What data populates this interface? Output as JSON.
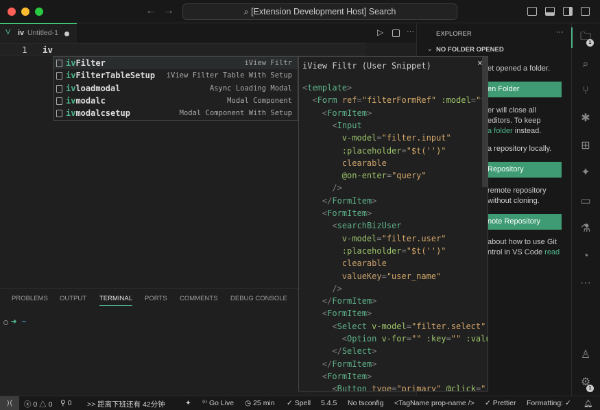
{
  "title": {
    "search": "[Extension Development Host] Search"
  },
  "tab": {
    "name": "iv",
    "file": "Untitled-1"
  },
  "editor": {
    "line_number": "1",
    "text": "iv"
  },
  "suggest": [
    {
      "match": "iv",
      "rest": "Filter",
      "detail": "iView Filtr"
    },
    {
      "match": "iv",
      "rest": "FilterTableSetup",
      "detail": "iView Filter Table With Setup"
    },
    {
      "match": "iv",
      "rest": "loadmodal",
      "detail": "Async Loading Modal"
    },
    {
      "match": "iv",
      "rest": "modalc",
      "detail": "Modal Component"
    },
    {
      "match": "iv",
      "rest": "modalcsetup",
      "detail": "Modal Component With Setup"
    }
  ],
  "detail": {
    "title": "iView Filtr (User Snippet)",
    "close": "×",
    "code": [
      [
        [
          "b",
          "<"
        ],
        [
          "t",
          "template"
        ],
        [
          "b",
          ">"
        ]
      ],
      [
        [
          "p",
          "  "
        ],
        [
          "b",
          "<"
        ],
        [
          "t",
          "Form "
        ],
        [
          "a",
          "ref"
        ],
        [
          "b",
          "="
        ],
        [
          "s",
          "\"filterFormRef\""
        ],
        [
          "p",
          " "
        ],
        [
          "v",
          ":model"
        ],
        [
          "b",
          "="
        ],
        [
          "s",
          "\"f"
        ]
      ],
      [
        [
          "p",
          "    "
        ],
        [
          "b",
          "<"
        ],
        [
          "t",
          "FormItem"
        ],
        [
          "b",
          ">"
        ]
      ],
      [
        [
          "p",
          "      "
        ],
        [
          "b",
          "<"
        ],
        [
          "t",
          "Input"
        ]
      ],
      [
        [
          "p",
          "        "
        ],
        [
          "v",
          "v-model"
        ],
        [
          "b",
          "="
        ],
        [
          "s",
          "\"filter.input\""
        ]
      ],
      [
        [
          "p",
          "        "
        ],
        [
          "v",
          ":placeholder"
        ],
        [
          "b",
          "="
        ],
        [
          "s",
          "\"$t('')\""
        ]
      ],
      [
        [
          "p",
          "        "
        ],
        [
          "a",
          "clearable"
        ]
      ],
      [
        [
          "p",
          "        "
        ],
        [
          "v",
          "@on-enter"
        ],
        [
          "b",
          "="
        ],
        [
          "s",
          "\"query\""
        ]
      ],
      [
        [
          "p",
          "      "
        ],
        [
          "b",
          "/>"
        ]
      ],
      [
        [
          "p",
          "    "
        ],
        [
          "b",
          "</"
        ],
        [
          "t",
          "FormItem"
        ],
        [
          "b",
          ">"
        ]
      ],
      [
        [
          "p",
          "    "
        ],
        [
          "b",
          "<"
        ],
        [
          "t",
          "FormItem"
        ],
        [
          "b",
          ">"
        ]
      ],
      [
        [
          "p",
          "      "
        ],
        [
          "b",
          "<"
        ],
        [
          "t",
          "searchBizUser"
        ]
      ],
      [
        [
          "p",
          "        "
        ],
        [
          "v",
          "v-model"
        ],
        [
          "b",
          "="
        ],
        [
          "s",
          "\"filter.user\""
        ]
      ],
      [
        [
          "p",
          "        "
        ],
        [
          "v",
          ":placeholder"
        ],
        [
          "b",
          "="
        ],
        [
          "s",
          "\"$t('')\""
        ]
      ],
      [
        [
          "p",
          "        "
        ],
        [
          "a",
          "clearable"
        ]
      ],
      [
        [
          "p",
          "        "
        ],
        [
          "a",
          "valueKey"
        ],
        [
          "b",
          "="
        ],
        [
          "s",
          "\"user_name\""
        ]
      ],
      [
        [
          "p",
          "      "
        ],
        [
          "b",
          "/>"
        ]
      ],
      [
        [
          "p",
          "    "
        ],
        [
          "b",
          "</"
        ],
        [
          "t",
          "FormItem"
        ],
        [
          "b",
          ">"
        ]
      ],
      [
        [
          "p",
          "    "
        ],
        [
          "b",
          "<"
        ],
        [
          "t",
          "FormItem"
        ],
        [
          "b",
          ">"
        ]
      ],
      [
        [
          "p",
          "      "
        ],
        [
          "b",
          "<"
        ],
        [
          "t",
          "Select "
        ],
        [
          "v",
          "v-model"
        ],
        [
          "b",
          "="
        ],
        [
          "s",
          "\"filter.select\""
        ]
      ],
      [
        [
          "p",
          "        "
        ],
        [
          "b",
          "<"
        ],
        [
          "t",
          "Option "
        ],
        [
          "v",
          "v-for"
        ],
        [
          "b",
          "="
        ],
        [
          "s",
          "\"\""
        ],
        [
          "p",
          " "
        ],
        [
          "v",
          ":key"
        ],
        [
          "b",
          "="
        ],
        [
          "s",
          "\"\""
        ],
        [
          "p",
          " "
        ],
        [
          "v",
          ":valu"
        ]
      ],
      [
        [
          "p",
          "      "
        ],
        [
          "b",
          "</"
        ],
        [
          "t",
          "Select"
        ],
        [
          "b",
          ">"
        ]
      ],
      [
        [
          "p",
          "    "
        ],
        [
          "b",
          "</"
        ],
        [
          "t",
          "FormItem"
        ],
        [
          "b",
          ">"
        ]
      ],
      [
        [
          "p",
          "    "
        ],
        [
          "b",
          "<"
        ],
        [
          "t",
          "FormItem"
        ],
        [
          "b",
          ">"
        ]
      ],
      [
        [
          "p",
          "      "
        ],
        [
          "b",
          "<"
        ],
        [
          "t",
          "Button "
        ],
        [
          "a",
          "type"
        ],
        [
          "b",
          "="
        ],
        [
          "s",
          "\"primary\""
        ],
        [
          "p",
          " "
        ],
        [
          "v",
          "@click"
        ],
        [
          "b",
          "="
        ],
        [
          "s",
          "\"("
        ]
      ]
    ]
  },
  "panel": {
    "tabs": [
      "PROBLEMS",
      "OUTPUT",
      "TERMINAL",
      "PORTS",
      "COMMENTS",
      "DEBUG CONSOLE"
    ],
    "active": "TERMINAL",
    "prompt_arrow": "➜",
    "prompt_dir": "~"
  },
  "sidebar": {
    "title": "EXPLORER",
    "section": "NO FOLDER OPENED",
    "t1": "et opened a folder.",
    "btn1": "en Folder",
    "t2a": "er will close all",
    "t2b": "editors. To keep",
    "t2c_link": "a folder",
    "t2c": " instead.",
    "t3": "a repository locally.",
    "btn2": " Repository",
    "t4a": " remote repository",
    "t4b": "without cloning.",
    "btn3": "note Repository",
    "t5a": "about how to use Git",
    "t5b": "ntrol in VS Code ",
    "t5_link": "read"
  },
  "activity": {
    "explorer_badge": "1",
    "accounts_badge": "1"
  },
  "status": {
    "errors": "0",
    "warnings": "0",
    "ports": "0",
    "countdown": ">> 距离下班还有 42分钟",
    "golive": "Go Live",
    "timer": "25 min",
    "spell": "Spell",
    "version": "5.4.5",
    "tsconfig": "No tsconfig",
    "tagname": "<TagName prop-name />",
    "prettier": "Prettier",
    "formatting": "Formatting: ✓"
  },
  "colors": {
    "accent": "#3f9b74",
    "match": "#4fb68c"
  }
}
